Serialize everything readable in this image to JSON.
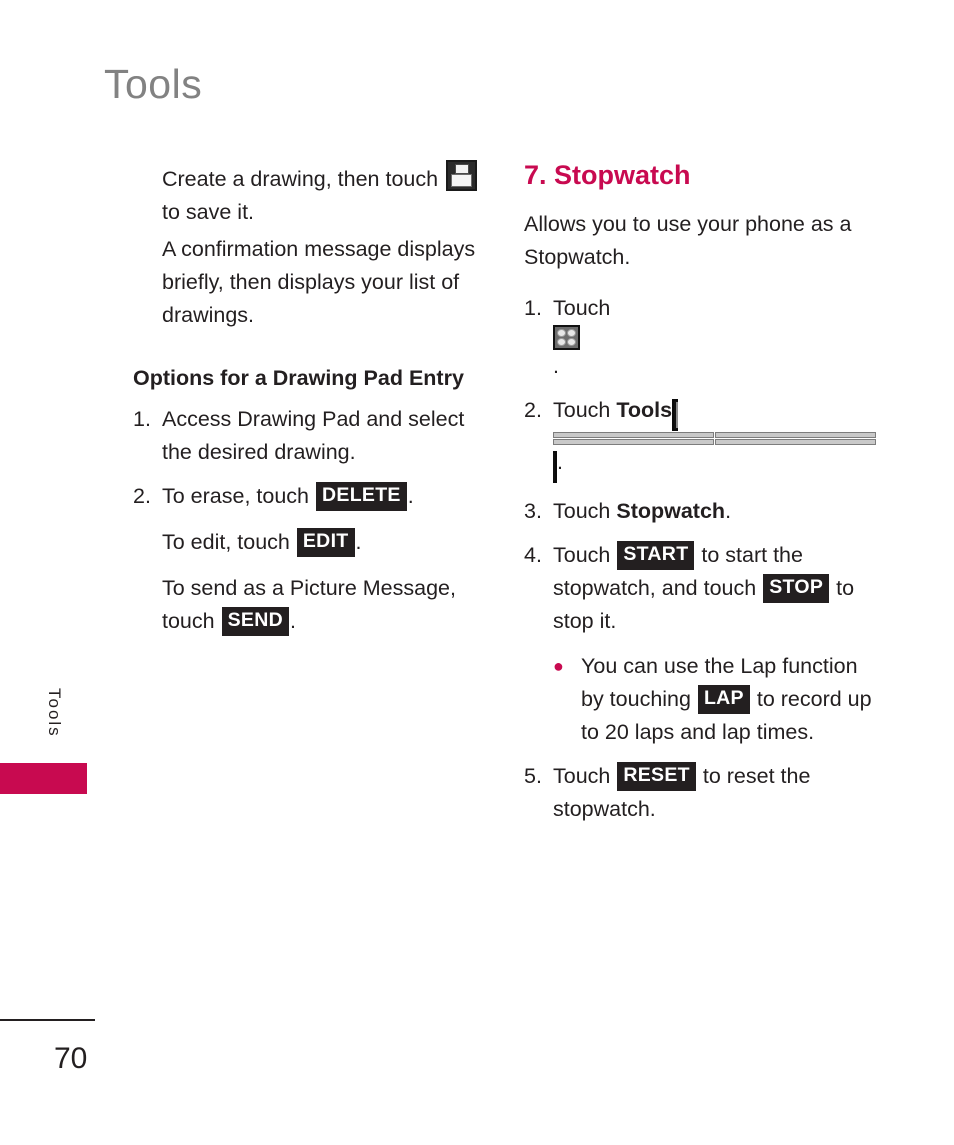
{
  "page": {
    "header_title": "Tools",
    "side_tab_label": "Tools",
    "page_number": "70",
    "accent_color": "#c80a50",
    "header_color": "#828282",
    "text_color": "#231f20"
  },
  "left_column": {
    "blocks": [
      {
        "kind": "para",
        "prefix": "Create a drawing, then touch",
        "icon": "save-icon",
        "suffix": "to save it."
      },
      {
        "kind": "para",
        "text": "A confirmation message displays briefly, then displays your list of drawings."
      },
      {
        "kind": "subhead",
        "text": "Options for a Drawing Pad Entry"
      },
      {
        "kind": "numbered",
        "num": "1.",
        "text": "Access Drawing Pad and select the desired drawing."
      },
      {
        "kind": "numbered-key",
        "num": "2.",
        "before": "To erase, touch",
        "key": "DELETE",
        "after": "."
      },
      {
        "kind": "para-key",
        "before": "To edit, touch",
        "key": "EDIT",
        "after": "."
      },
      {
        "kind": "para-key",
        "before": "To send as a Picture Message, touch",
        "key": "SEND",
        "after": "."
      }
    ]
  },
  "right_column": {
    "section_heading": "7. Stopwatch",
    "lede": "Allows you to use your phone as a Stopwatch.",
    "steps": [
      {
        "num": "1.",
        "before": "Touch",
        "icon": "grid-menu-icon",
        "after": "."
      },
      {
        "num": "2.",
        "before": "Touch",
        "bold": "Tools",
        "icon": "tools-calculator-icon",
        "after": "."
      },
      {
        "num": "3.",
        "before": "Touch",
        "bold": "Stopwatch",
        "after": "."
      },
      {
        "num": "4.",
        "before": "Touch",
        "key1": "START",
        "mid": "to start the stopwatch, and touch",
        "key2": "STOP",
        "after": "to stop it."
      },
      {
        "num": "5.",
        "before": "Touch",
        "key1": "RESET",
        "after": "to reset the stopwatch."
      }
    ],
    "bullet": {
      "before": "You can use the Lap function by touching",
      "key": "LAP",
      "after": "to record up to 20 laps and lap times."
    }
  }
}
